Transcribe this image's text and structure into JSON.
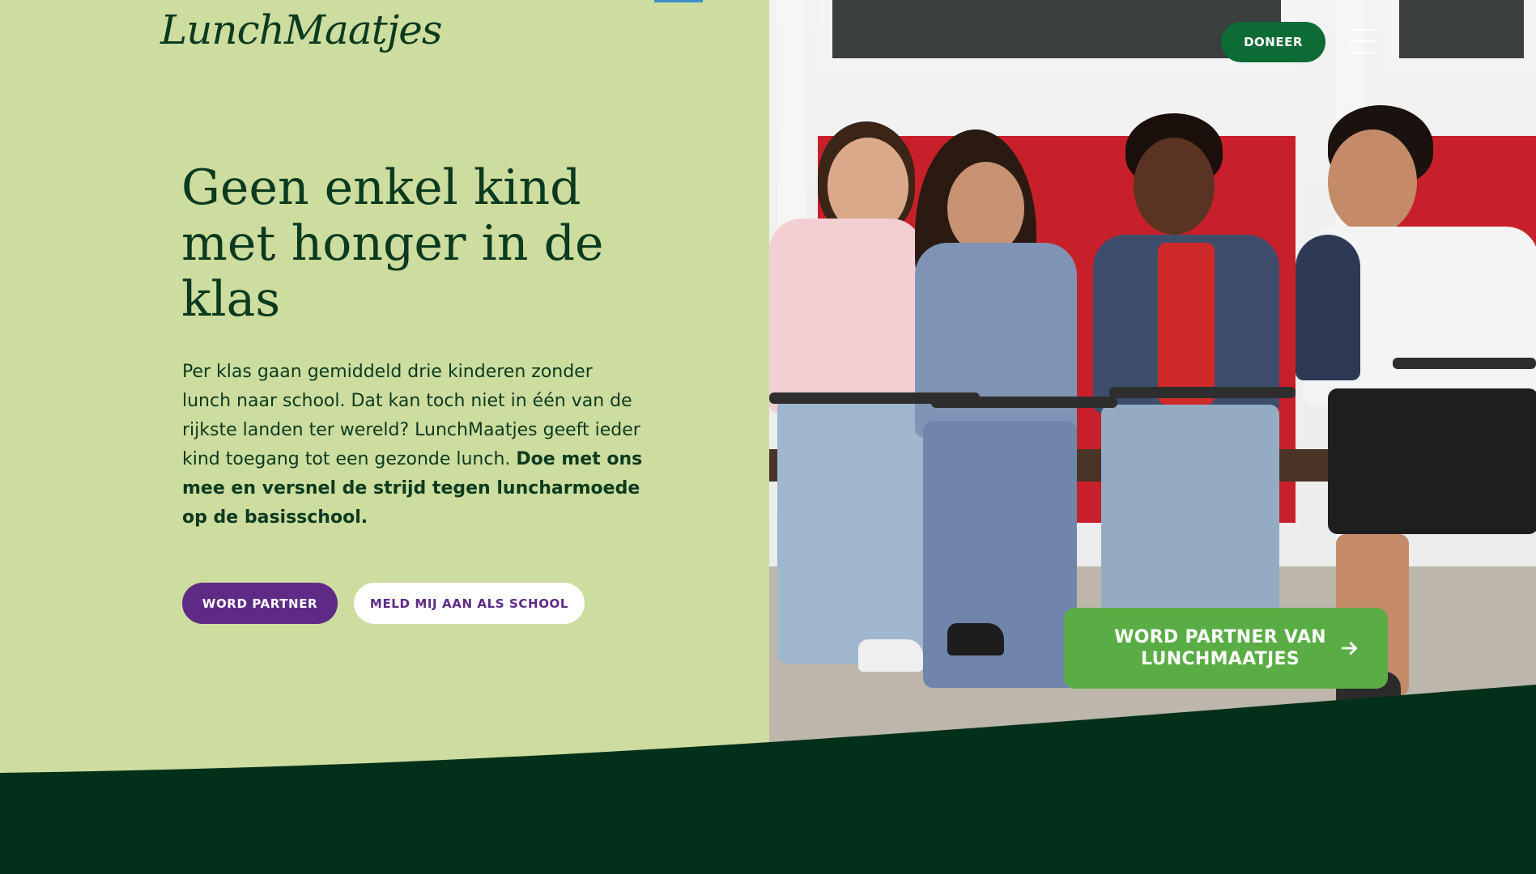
{
  "brand": {
    "logo_text": "LunchMaatjes"
  },
  "header": {
    "donate_label": "DONEER",
    "menu_icon": "hamburger-icon"
  },
  "hero": {
    "headline": "Geen enkel kind met honger in de klas",
    "lead_text": "Per klas gaan gemiddeld drie kinderen zonder lunch naar school. Dat kan toch niet in één van de rijkste landen ter wereld? LunchMaatjes geeft ieder kind toegang tot een gezonde lunch. ",
    "lead_emphasis": "Doe met ons mee en versnel de strijd tegen luncharmoede op de basisschool.",
    "primary_button": "WORD PARTNER",
    "secondary_button": "MELD MIJ AAN ALS SCHOOL"
  },
  "cta": {
    "label": "WORD PARTNER VAN LUNCHMAATJES",
    "icon": "arrow-right-icon"
  },
  "colors": {
    "background": "#cddd9f",
    "dark_green": "#0b3a1f",
    "donate_green": "#0d6b35",
    "purple": "#5e2a86",
    "cta_green": "#5aad45",
    "footer_green": "#03301a"
  }
}
